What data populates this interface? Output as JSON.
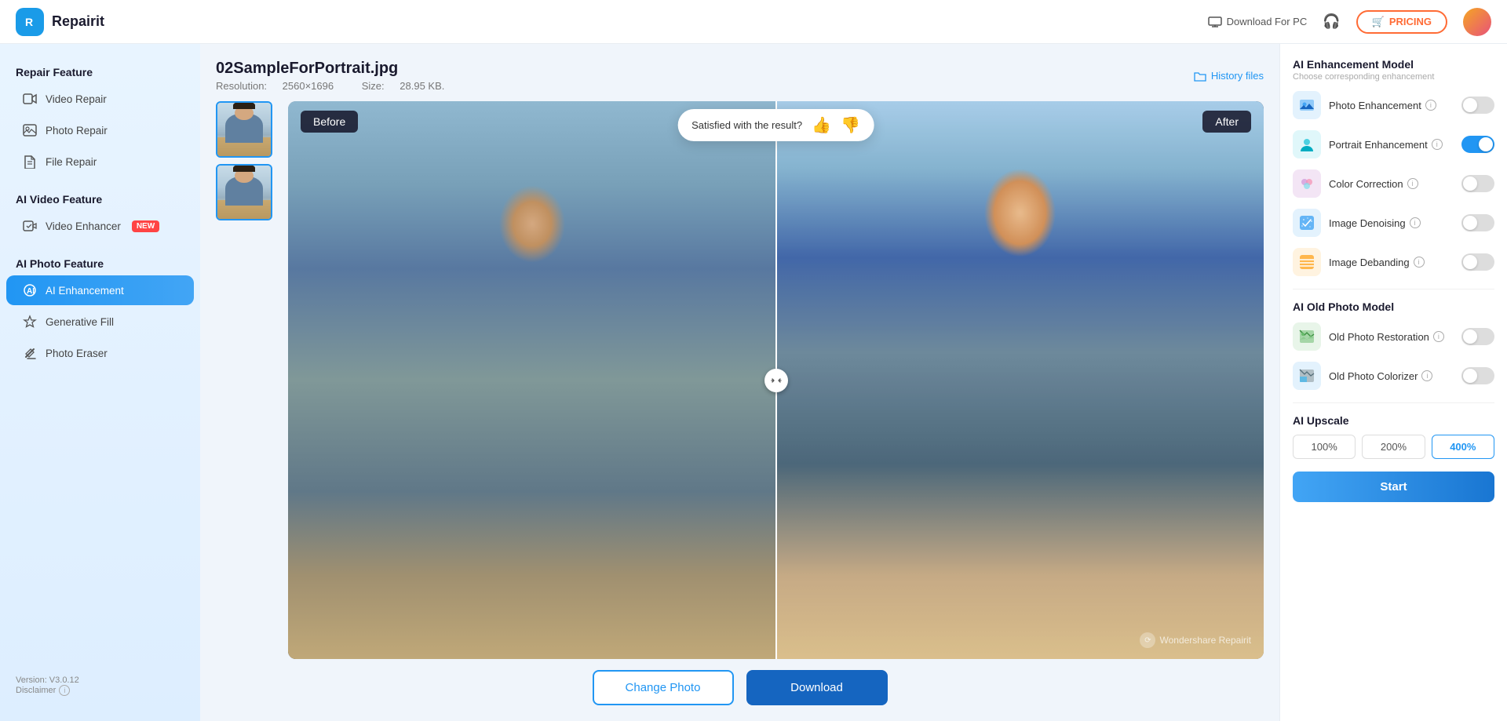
{
  "header": {
    "logo_letter": "R",
    "app_name": "Repairit",
    "download_pc_label": "Download For PC",
    "pricing_label": "PRICING",
    "pricing_icon": "🛒"
  },
  "sidebar": {
    "repair_feature_title": "Repair Feature",
    "video_repair_label": "Video Repair",
    "photo_repair_label": "Photo Repair",
    "file_repair_label": "File Repair",
    "ai_video_title": "AI Video Feature",
    "video_enhancer_label": "Video Enhancer",
    "new_badge": "NEW",
    "ai_photo_title": "AI Photo Feature",
    "ai_enhancement_label": "AI Enhancement",
    "generative_fill_label": "Generative Fill",
    "photo_eraser_label": "Photo Eraser",
    "version": "Version: V3.0.12",
    "disclaimer": "Disclaimer"
  },
  "file_info": {
    "filename": "02SampleForPortrait.jpg",
    "resolution_label": "Resolution:",
    "resolution_value": "2560×1696",
    "size_label": "Size:",
    "size_value": "28.95 KB.",
    "history_label": "History files"
  },
  "image_viewer": {
    "before_label": "Before",
    "after_label": "After",
    "satisfaction_text": "Satisfied with the result?",
    "watermark": "Wondershare Repairit"
  },
  "bottom_actions": {
    "change_photo": "Change Photo",
    "download": "Download"
  },
  "right_panel": {
    "model_title": "AI Enhancement Model",
    "model_subtitle": "Choose corresponding enhancement",
    "photo_enhancement_label": "Photo Enhancement",
    "portrait_enhancement_label": "Portrait Enhancement",
    "color_correction_label": "Color Correction",
    "image_denoising_label": "Image Denoising",
    "image_debanding_label": "Image Debanding",
    "old_photo_model_title": "AI Old Photo Model",
    "old_photo_restoration_label": "Old Photo Restoration",
    "old_photo_colorizer_label": "Old Photo Colorizer",
    "upscale_title": "AI Upscale",
    "upscale_100": "100%",
    "upscale_200": "200%",
    "upscale_400": "400%",
    "start_label": "Start",
    "toggles": {
      "photo_enhancement": "off",
      "portrait_enhancement": "on",
      "color_correction": "off",
      "image_denoising": "off",
      "image_debanding": "off",
      "old_photo_restoration": "off",
      "old_photo_colorizer": "off"
    },
    "active_upscale": "400%"
  }
}
